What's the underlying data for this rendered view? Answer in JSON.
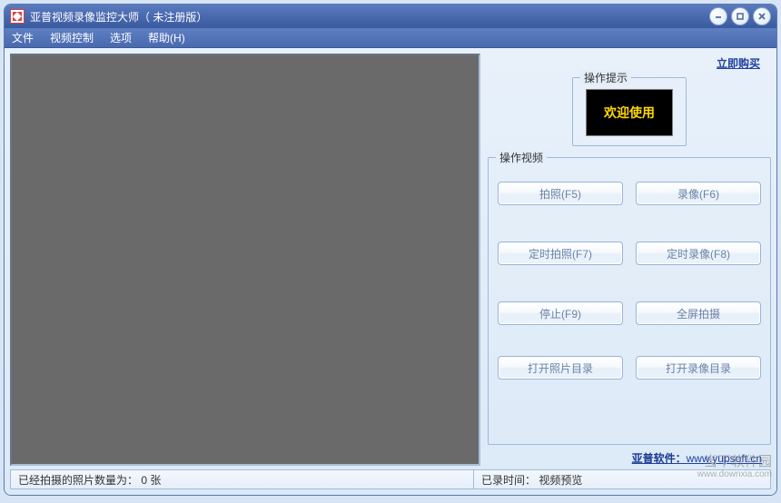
{
  "titlebar": {
    "title": "亚普视频录像监控大师（ 未注册版）"
  },
  "menu": {
    "file": "文件",
    "video_control": "视频控制",
    "options": "选项",
    "help": "帮助(H)"
  },
  "links": {
    "buy_now": "立即购买",
    "site_prefix": "亚普软件：",
    "site_url": "www.yupsoft.cn"
  },
  "hint": {
    "legend": "操作提示",
    "welcome": "欢迎使用"
  },
  "ops": {
    "legend": "操作视频",
    "photo": "拍照(F5)",
    "record": "录像(F6)",
    "timed_photo": "定时拍照(F7)",
    "timed_record": "定时录像(F8)",
    "stop": "停止(F9)",
    "fullscreen": "全屏拍摄",
    "open_photo_dir": "打开照片目录",
    "open_record_dir": "打开录像目录"
  },
  "status": {
    "photo_count": "已经拍摄的照片数量为： 0  张",
    "record_time": "已录时间： 视频预览"
  },
  "watermark": {
    "main": "当下软件园",
    "sub": "www.downxia.com"
  }
}
